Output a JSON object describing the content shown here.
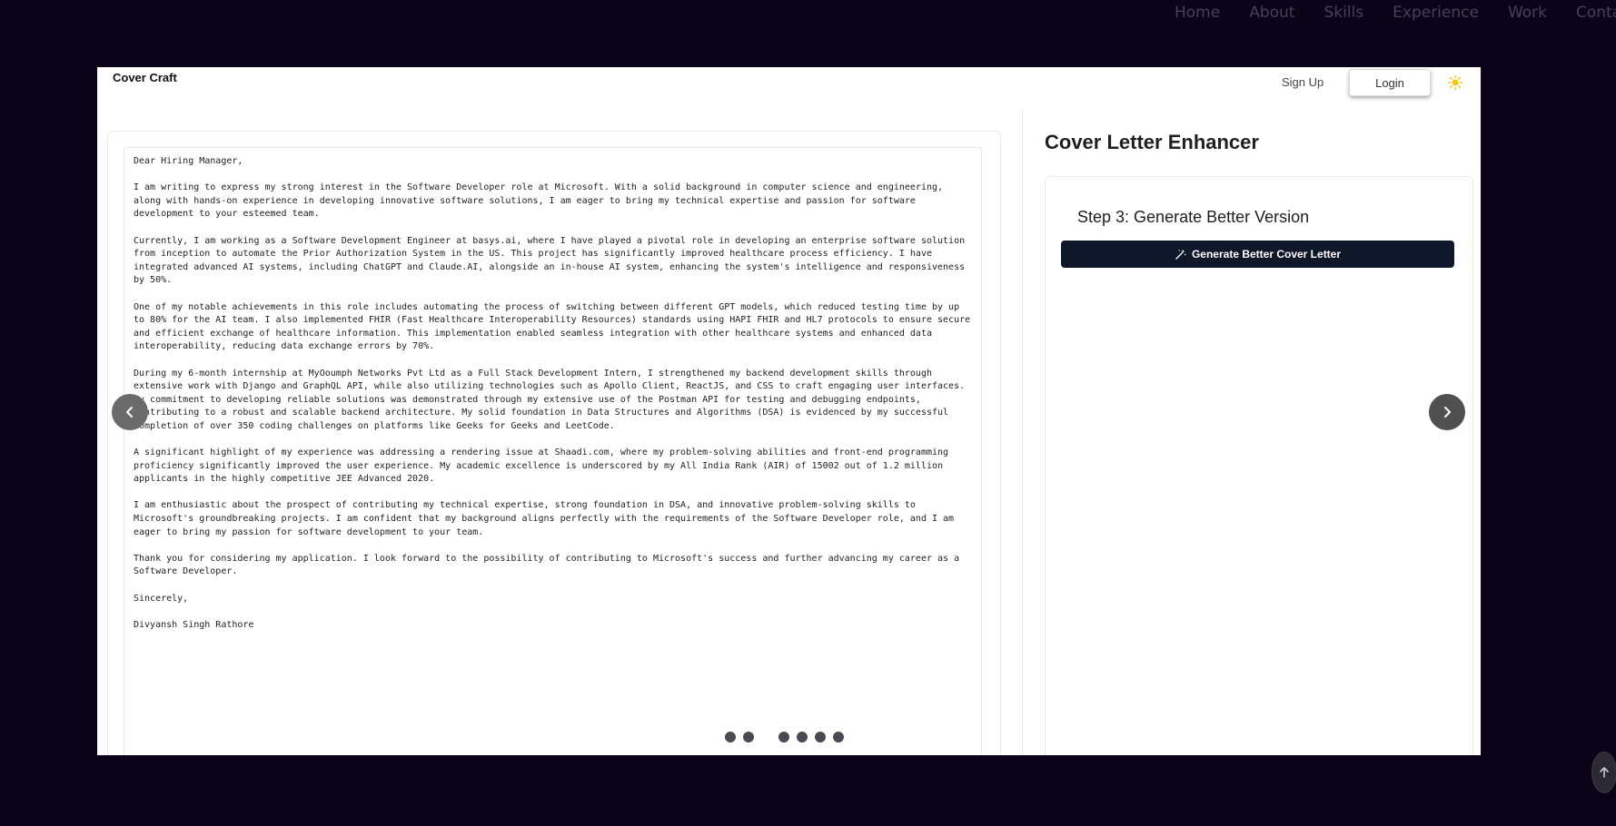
{
  "site_nav": {
    "items": [
      "Home",
      "About",
      "Skills",
      "Experience",
      "Work",
      "Contac"
    ]
  },
  "app": {
    "brand": "Cover Craft",
    "signup_label": "Sign Up",
    "login_label": "Login",
    "theme_icon": "sun-icon",
    "accent_color": "#f5c518"
  },
  "letter": {
    "paragraphs": [
      "Dear Hiring Manager,",
      "I am writing to express my strong interest in the Software Developer role at Microsoft. With a solid background in computer science and engineering, along with hands-on experience in developing innovative software solutions, I am eager to bring my technical expertise and passion for software development to your esteemed team.",
      "Currently, I am working as a Software Development Engineer at basys.ai, where I have played a pivotal role in developing an enterprise software solution from inception to automate the Prior Authorization System in the US. This project has significantly improved healthcare process efficiency. I have integrated advanced AI systems, including ChatGPT and Claude.AI, alongside an in-house AI system, enhancing the system's intelligence and responsiveness by 50%.",
      "One of my notable achievements in this role includes automating the process of switching between different GPT models, which reduced testing time by up to 80% for the AI team. I also implemented FHIR (Fast Healthcare Interoperability Resources) standards using HAPI FHIR and HL7 protocols to ensure secure and efficient exchange of healthcare information. This implementation enabled seamless integration with other healthcare systems and enhanced data interoperability, reducing data exchange errors by 70%.",
      "During my 6-month internship at MyOoumph Networks Pvt Ltd as a Full Stack Development Intern, I strengthened my backend development skills through extensive work with Django and GraphQL API, while also utilizing technologies such as Apollo Client, ReactJS, and CSS to craft engaging user interfaces. My commitment to developing reliable solutions was demonstrated through my extensive use of the Postman API for testing and debugging endpoints, contributing to a robust and scalable backend architecture. My solid foundation in Data Structures and Algorithms (DSA) is evidenced by my successful completion of over 350 coding challenges on platforms like Geeks for Geeks and LeetCode.",
      "A significant highlight of my experience was addressing a rendering issue at Shaadi.com, where my problem-solving abilities and front-end programming proficiency significantly improved the user experience. My academic excellence is underscored by my All India Rank (AIR) of 15002 out of 1.2 million applicants in the highly competitive JEE Advanced 2020.",
      "I am enthusiastic about the prospect of contributing my technical expertise, strong foundation in DSA, and innovative problem-solving skills to Microsoft's groundbreaking projects. I am confident that my background aligns perfectly with the requirements of the Software Developer role, and I am eager to bring my passion for software development to your team.",
      "Thank you for considering my application. I look forward to the possibility of contributing to Microsoft's success and further advancing my career as a Software Developer.",
      "Sincerely,",
      "Divyansh Singh Rathore"
    ]
  },
  "enhancer": {
    "title": "Cover Letter Enhancer",
    "step_title": "Step 3: Generate Better Version",
    "generate_label": "Generate Better Cover Letter",
    "generate_icon": "magic-wand-icon",
    "button_color": "#0f172a"
  },
  "carousel": {
    "prev_icon": "chevron-left-icon",
    "next_icon": "chevron-right-icon",
    "dot_count": 6
  },
  "scroll_top_icon": "arrow-up-icon"
}
